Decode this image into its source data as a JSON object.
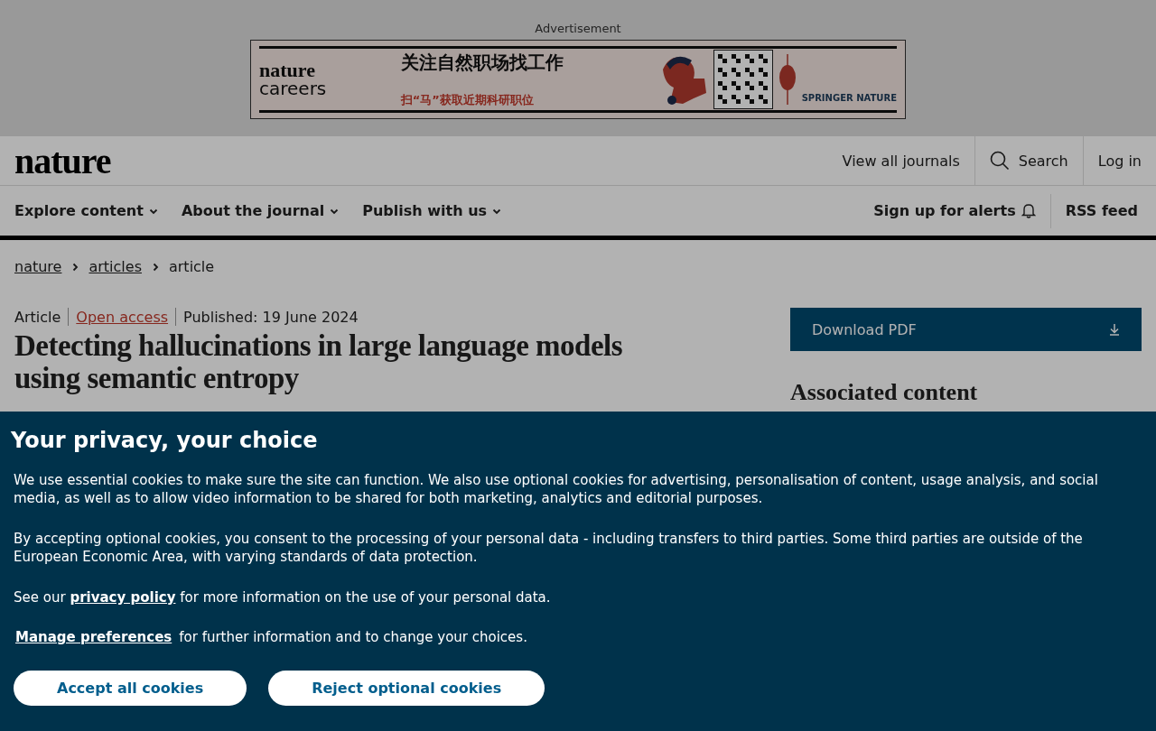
{
  "advertisement": {
    "label": "Advertisement",
    "ad": {
      "brand_line_1": "nature",
      "brand_line_2": "careers",
      "headline": "关注自然职场找工作",
      "subline": "扫“马”获取近期科研职位",
      "sponsor": "SPRINGER NATURE"
    }
  },
  "header": {
    "logo": "nature",
    "links": [
      {
        "label": "View all journals",
        "kind": "text"
      },
      {
        "label": "Search",
        "kind": "search"
      },
      {
        "label": "Log in",
        "kind": "text"
      }
    ]
  },
  "nav": {
    "menus": [
      "Explore content",
      "About the journal",
      "Publish with us"
    ],
    "alerts": "Sign up for alerts",
    "rss": "RSS feed"
  },
  "breadcrumb": [
    {
      "label": "nature",
      "link": true
    },
    {
      "label": "articles",
      "link": true
    },
    {
      "label": "article",
      "link": false
    }
  ],
  "article": {
    "type": "Article",
    "access": "Open access",
    "published": "Published: 19 June 2024",
    "title": "Detecting hallucinations in large language models using semantic entropy"
  },
  "sidebar": {
    "download": "Download PDF",
    "heading": "Associated content"
  },
  "cookie_banner": {
    "title": "Your privacy, your choice",
    "paragraphs": [
      "We use essential cookies to make sure the site can function. We also use optional cookies for advertising, personalisation of content, usage analysis, and social media, as well as to allow video information to be shared for both marketing, analytics and editorial purposes.",
      "By accepting optional cookies, you consent to the processing of your personal data - including transfers to third parties. Some third parties are outside of the European Economic Area, with varying standards of data protection."
    ],
    "policy_prefix": "See our",
    "policy_link": "privacy policy",
    "policy_suffix": "for more information on the use of your personal data.",
    "manage_link": "Manage preferences",
    "manage_suffix": "for further information and to change your choices.",
    "buttons": [
      "Accept all cookies",
      "Reject optional cookies"
    ]
  }
}
